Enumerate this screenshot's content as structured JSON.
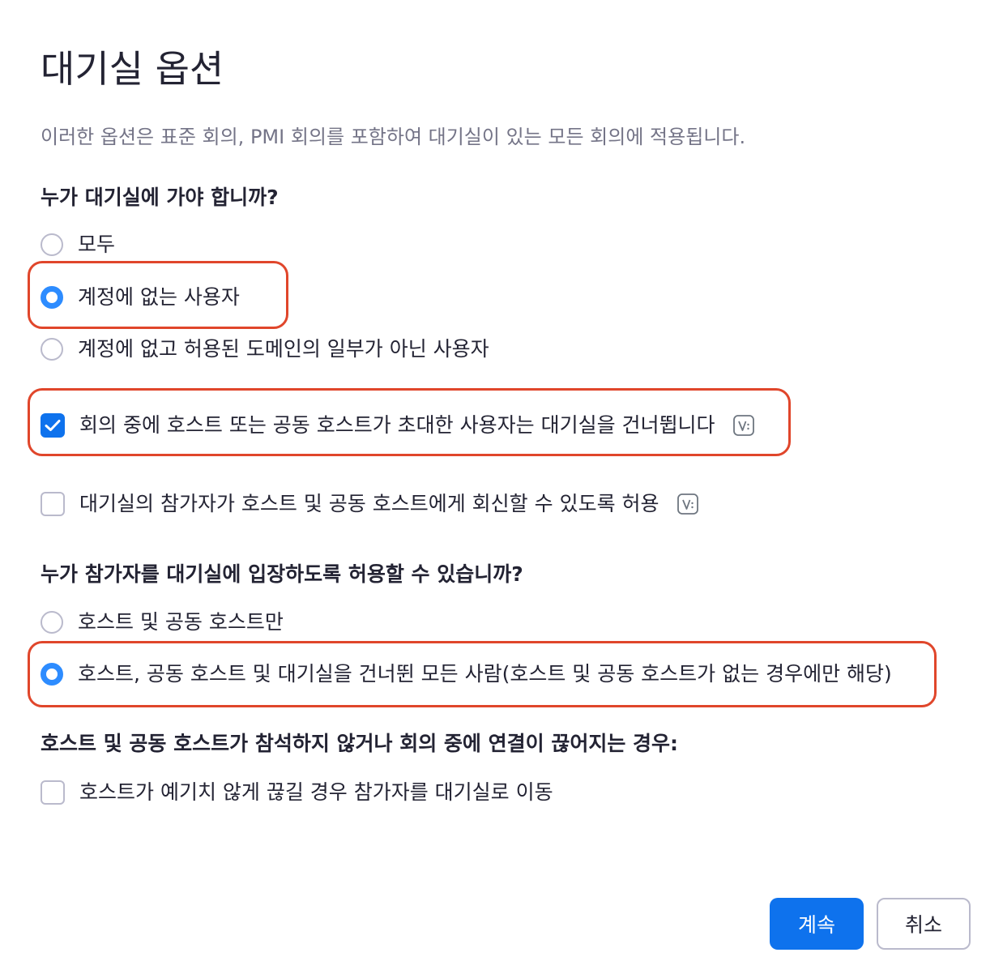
{
  "dialog": {
    "title": "대기실 옵션",
    "description": "이러한 옵션은 표준 회의, PMI 회의를 포함하여 대기실이 있는 모든 회의에 적용됩니다."
  },
  "who_goes": {
    "heading": "누가 대기실에 가야 합니까?",
    "options": [
      {
        "label": "모두",
        "selected": false
      },
      {
        "label": "계정에 없는 사용자",
        "selected": true
      },
      {
        "label": "계정에 없고 허용된 도메인의 일부가 아닌 사용자",
        "selected": false
      }
    ]
  },
  "checks": {
    "skip_invited": {
      "label": "회의 중에 호스트 또는 공동 호스트가 초대한 사용자는 대기실을 건너뜁니다",
      "checked": true,
      "icon": "version-badge-icon"
    },
    "allow_reply": {
      "label": "대기실의 참가자가 호스트 및 공동 호스트에게 회신할 수 있도록 허용",
      "checked": false,
      "icon": "version-badge-icon"
    }
  },
  "who_admits": {
    "heading": "누가 참가자를 대기실에 입장하도록 허용할 수 있습니까?",
    "options": [
      {
        "label": "호스트 및 공동 호스트만",
        "selected": false
      },
      {
        "label": "호스트, 공동 호스트 및 대기실을 건너뛴 모든 사람(호스트 및 공동 호스트가 없는 경우에만 해당)",
        "selected": true
      }
    ]
  },
  "host_absent": {
    "heading": "호스트 및 공동 호스트가 참석하지 않거나 회의 중에 연결이 끊어지는 경우:",
    "option": {
      "label": "호스트가 예기치 않게 끊길 경우 참가자를 대기실로 이동",
      "checked": false
    }
  },
  "buttons": {
    "continue": "계속",
    "cancel": "취소"
  },
  "colors": {
    "accent": "#0e72ed",
    "radio_accent": "#2d8cff",
    "highlight": "#e0462b",
    "muted_text": "#747487"
  }
}
